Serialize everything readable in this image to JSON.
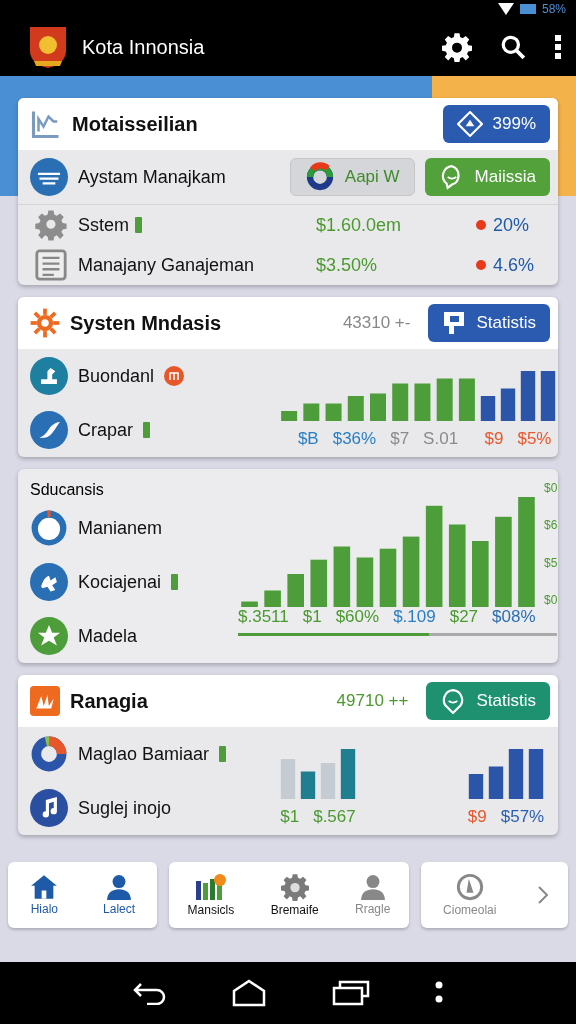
{
  "status_bar": {
    "battery": "58%"
  },
  "app_bar": {
    "title": "Kota Innonsia"
  },
  "summary_card": {
    "title": "Motaisseilian",
    "button": "399%",
    "service": {
      "name": "Aystam Manajkam",
      "buttons": [
        {
          "label": "Aapi W",
          "kind": "ring"
        },
        {
          "label": "Maiissia",
          "kind": "chat"
        }
      ]
    },
    "rows": [
      {
        "name": "Sstem",
        "amount": "$1.60.0em",
        "change": "20%"
      },
      {
        "name": "Manajany Ganajeman",
        "amount": "$3.50%",
        "change": "4.6%"
      }
    ]
  },
  "cards": [
    {
      "kind": "split",
      "title": "Systen Mndasis",
      "count": "43310 +-",
      "button": {
        "label": "Statistis",
        "kind": "blue"
      },
      "rows": [
        {
          "name": "Buondanl"
        },
        {
          "name": "Crapar"
        }
      ],
      "groups": [
        {
          "labels": [
            {
              "text": "$B",
              "color": "#2a7fc4"
            },
            {
              "text": "$36%",
              "color": "#2a7fc4"
            },
            {
              "text": "$7",
              "color": "#8a8a8a"
            },
            {
              "text": "S.01",
              "color": "#8a8a8a"
            }
          ]
        },
        {
          "labels": [
            {
              "text": "$9",
              "color": "#e8572a"
            },
            {
              "text": "$5%",
              "color": "#e8572a"
            }
          ]
        }
      ]
    },
    {
      "kind": "wide",
      "title": "Sducansis",
      "rows": [
        {
          "name": "Manianem"
        },
        {
          "name": "Kociajenai"
        },
        {
          "name": "Madela"
        }
      ],
      "axis": [
        "$0",
        "$6",
        "$5",
        "$0"
      ],
      "groups": [
        {
          "labels": [
            {
              "text": "$.3511",
              "color": "#4a9a2e"
            },
            {
              "text": "$1",
              "color": "#4a9a2e"
            },
            {
              "text": "$60%",
              "color": "#4a9a2e"
            },
            {
              "text": "$.109",
              "color": "#2a7fc4"
            },
            {
              "text": "$27",
              "color": "#4a9a2e"
            },
            {
              "text": "$08%",
              "color": "#2a6fb4"
            }
          ]
        }
      ]
    },
    {
      "kind": "split",
      "title": "Ranagia",
      "count": "49710 ++",
      "button": {
        "label": "Statistis",
        "kind": "teal"
      },
      "rows": [
        {
          "name": "Maglao Bamiaar"
        },
        {
          "name": "Suglej inojo"
        }
      ],
      "groups": [
        {
          "labels": [
            {
              "text": "$1",
              "color": "#4a9a2e"
            },
            {
              "text": "$.567",
              "color": "#4a9a2e"
            }
          ]
        },
        {
          "labels": [
            {
              "text": "$9",
              "color": "#e8572a"
            },
            {
              "text": "$57%",
              "color": "#2a5fb0"
            }
          ]
        }
      ]
    }
  ],
  "bottom_nav": [
    [
      {
        "label": "Hialo",
        "kind": "blue"
      },
      {
        "label": "Lalect",
        "kind": "blue"
      }
    ],
    [
      {
        "label": "Mansicls",
        "kind": "dark"
      },
      {
        "label": "Bremaife",
        "kind": "dark"
      },
      {
        "label": "Rragle",
        "kind": "grey"
      }
    ],
    [
      {
        "label": "Ciomeolai",
        "kind": "grey"
      }
    ]
  ]
}
